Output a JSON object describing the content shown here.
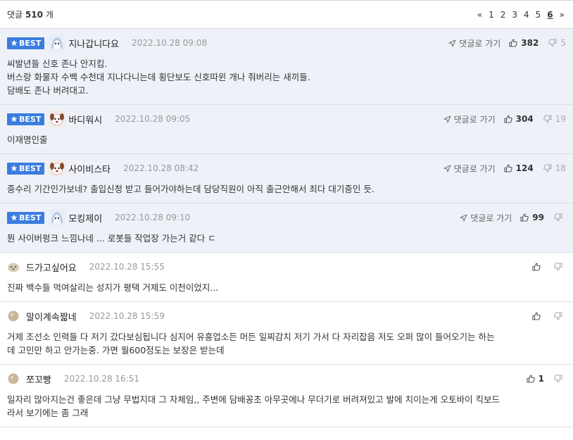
{
  "header": {
    "count_prefix": "댓글",
    "count_value": "510",
    "count_suffix": "개",
    "pager": [
      "«",
      "1",
      "2",
      "3",
      "4",
      "5",
      "6",
      "»"
    ],
    "current_page": "6"
  },
  "labels": {
    "best": "BEST",
    "goto": "댓글로 가기"
  },
  "best_comments": [
    {
      "nick": "지나갑니다요",
      "date": "2022.10.28 09:08",
      "up": "382",
      "down": "5",
      "lines": [
        "씨발년들 신호 존나 안지킴.",
        "버스랑 화물자 수백 수천대 지나다니는데 횡단보도 신호따윈 개나 줘버리는 새끼들.",
        "담배도 존나 버려대고."
      ]
    },
    {
      "nick": "바디워시",
      "date": "2022.10.28 09:05",
      "up": "304",
      "down": "19",
      "lines": [
        "이재명인줄"
      ]
    },
    {
      "nick": "사이비스타",
      "date": "2022.10.28 08:42",
      "up": "124",
      "down": "18",
      "lines": [
        "중수리 기간인가보네? 출입신청 받고 들어가야하는데 담당직원이 아직 출근안해서 죄다 대기중인 듯."
      ]
    },
    {
      "nick": "모킹제이",
      "date": "2022.10.28 09:10",
      "up": "99",
      "down": "",
      "lines": [
        "뭔 사이버펑크 느낌나네 ... 로봇들 작업장 가는거 같다 ㄷ"
      ]
    }
  ],
  "comments": [
    {
      "nick": "드가고싶어요",
      "date": "2022.10.28 15:55",
      "up": "",
      "down": "",
      "lines": [
        "진짜 백수들 먹여살리는 성지가 평택 거제도 이천이었지..."
      ]
    },
    {
      "nick": "말이계속짧네",
      "date": "2022.10.28 15:59",
      "up": "",
      "down": "",
      "lines": [
        "거제 조선소 인력들 다 저기 갔다보심됩니다 심지어 유흥업소든 머든 일찌감치 저기 가서 다 자리잡음 저도 오퍼 많이 들어오기는 하는",
        "데 고민만 하고 안가는중. 가면 월600정도는 보장은 받는데"
      ]
    },
    {
      "nick": "쪼꼬빵",
      "date": "2022.10.28 16:51",
      "up": "1",
      "down": "",
      "lines": [
        "일자리 많아지는건 좋은데 그냥 무법지대 그 자체임,, 주변에 담배꽁초 아무곳에나 무더기로 버려져있고 발에 치이는게 오토바이 킥보드",
        "라서 보기에는 좀 그래"
      ]
    }
  ]
}
